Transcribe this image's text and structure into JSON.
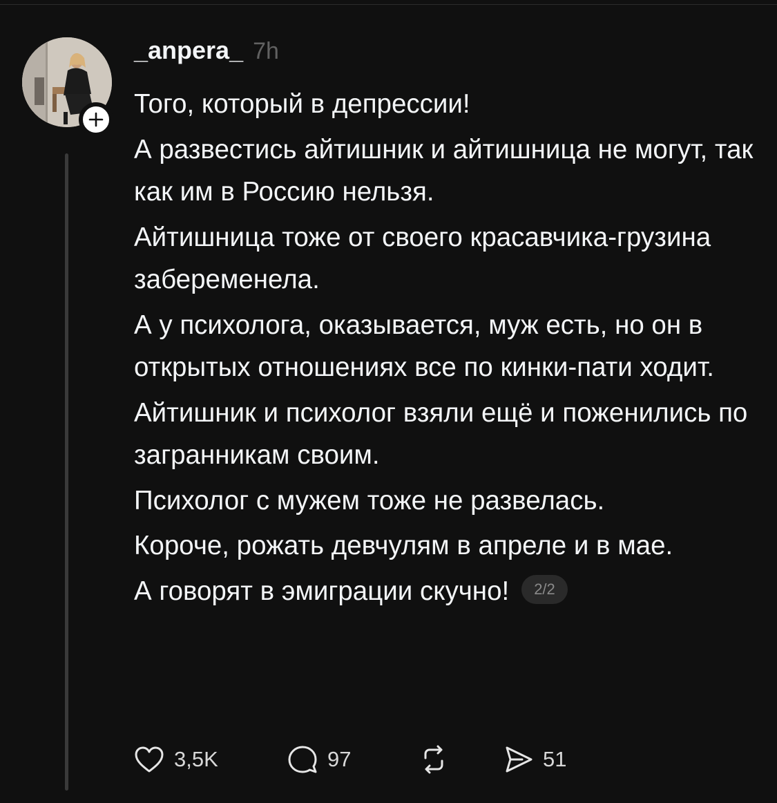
{
  "post": {
    "username": "_anpera_",
    "time": "7h",
    "paragraphs": [
      "Того, который в депрессии!",
      "А развестись айтишник и айтишница не могут, так как им в Россию нельзя.",
      "Айтишница тоже от своего красавчика-грузина забеременела.",
      "А у психолога, оказывается, муж есть, но он в открытых отношениях все по кинки-пати ходит.",
      "Айтишник и психолог взяли ещё и поженились по загранникам своим.",
      "Психолог с мужем тоже не развелась.",
      "Короче, рожать девчулям в апреле и в мае.",
      "А говорят в эмиграции скучно!"
    ],
    "page_indicator": "2/2"
  },
  "actions": {
    "likes": "3,5K",
    "replies": "97",
    "shares": "51"
  },
  "icons": {
    "like": "heart-icon",
    "reply": "comment-bubble-icon",
    "repost": "repost-icon",
    "share": "send-icon",
    "follow": "plus-icon"
  },
  "colors": {
    "background": "#101010",
    "text": "#f3f5f7",
    "muted": "#616161"
  }
}
